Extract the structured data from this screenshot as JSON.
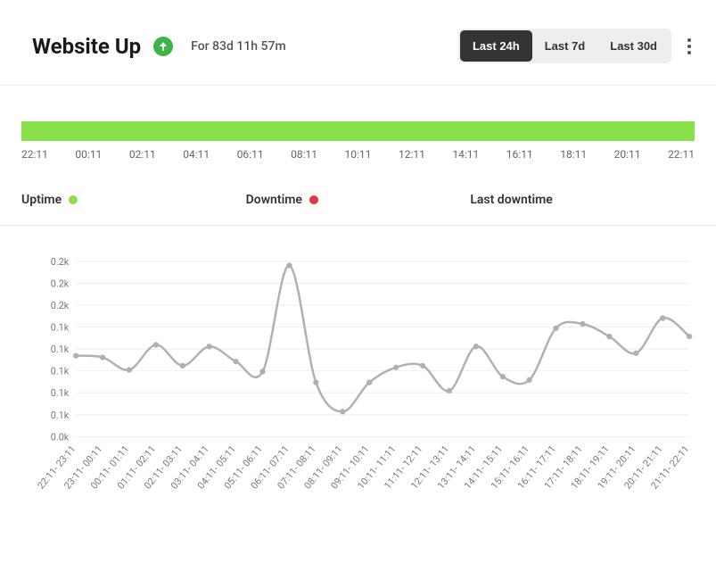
{
  "header": {
    "title": "Website Up",
    "duration": "For 83d 11h 57m"
  },
  "ranges": [
    {
      "label": "Last 24h",
      "active": true
    },
    {
      "label": "Last 7d",
      "active": false
    },
    {
      "label": "Last 30d",
      "active": false
    }
  ],
  "timeline": {
    "labels": [
      "22:11",
      "00:11",
      "02:11",
      "04:11",
      "06:11",
      "08:11",
      "10:11",
      "12:11",
      "14:11",
      "16:11",
      "18:11",
      "20:11",
      "22:11"
    ]
  },
  "legend": {
    "uptime": "Uptime",
    "downtime": "Downtime",
    "last_downtime": "Last downtime"
  },
  "chart": {
    "y_ticks": [
      "0.2k",
      "0.2k",
      "0.2k",
      "0.1k",
      "0.1k",
      "0.1k",
      "0.1k",
      "0.1k",
      "0.0k"
    ]
  },
  "chart_data": {
    "type": "line",
    "title": "",
    "xlabel": "",
    "ylabel": "",
    "ylim": [
      0,
      210
    ],
    "categories": [
      "22:11- 23:11",
      "23:11- 00:11",
      "00:11- 01:11",
      "01:11- 02:11",
      "02:11- 03:11",
      "03:11- 04:11",
      "04:11- 05:11",
      "05:11- 06:11",
      "06:11- 07:11",
      "07:11- 08:11",
      "08:11- 09:11",
      "09:11- 10:11",
      "10:11- 11:11",
      "11:11- 12:11",
      "12:11- 13:11",
      "13:11- 14:11",
      "14:11- 15:11",
      "15:11- 16:11",
      "16:11- 17:11",
      "17:11- 18:11",
      "18:11- 19:11",
      "19:11- 20:11",
      "20:11- 21:11",
      "21:11- 22:11"
    ],
    "values": [
      97,
      95,
      80,
      110,
      85,
      108,
      90,
      78,
      205,
      65,
      30,
      65,
      83,
      85,
      55,
      108,
      72,
      68,
      130,
      135,
      120,
      100,
      142,
      120
    ]
  }
}
